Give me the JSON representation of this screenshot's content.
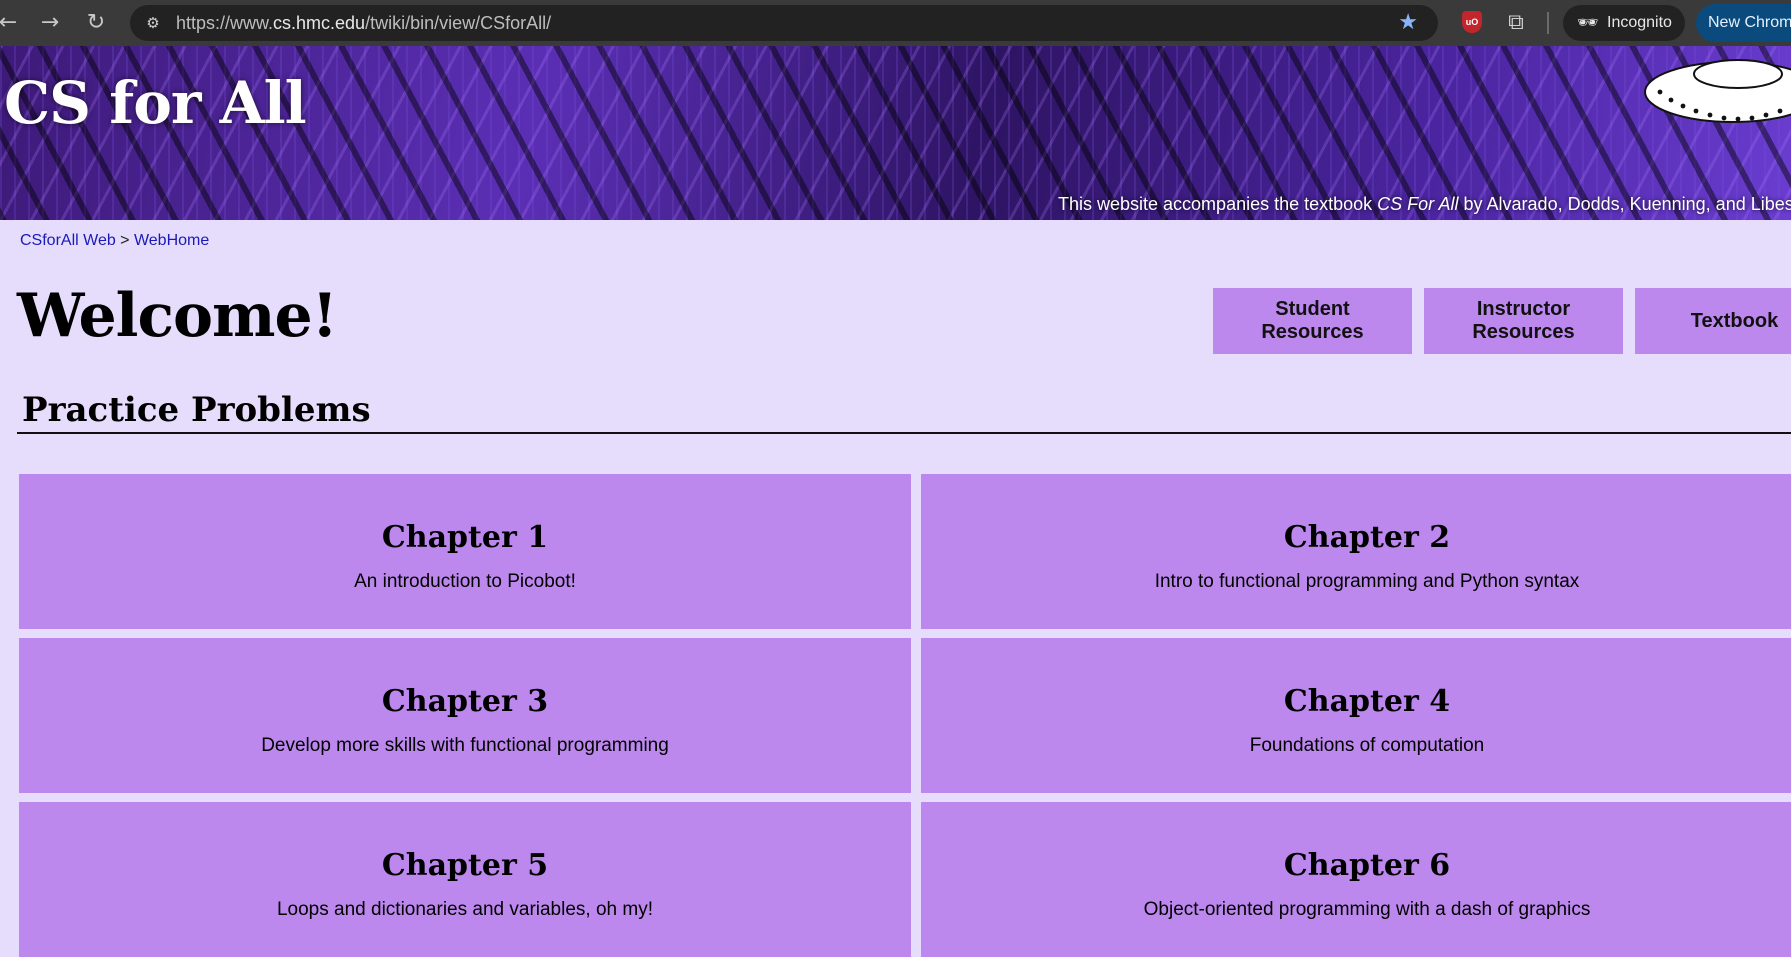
{
  "browser": {
    "back_icon": "arrow-left-icon",
    "forward_icon": "arrow-right-icon",
    "reload_icon": "reload-icon",
    "url_prefix": "https://www.",
    "url_host": "cs.hmc.edu",
    "url_path": "/twiki/bin/view/CSforAll/",
    "incognito_label": "Incognito",
    "new_chrome_label": "New Chrome",
    "ublock_label": "uO"
  },
  "banner": {
    "title": "CS for All",
    "tagline_pre": "This website accompanies the textbook ",
    "tagline_book": "CS For All",
    "tagline_post": " by Alvarado, Dodds, Kuenning, and Libeskind"
  },
  "breadcrumb": {
    "web": "CSforAll Web",
    "separator": " > ",
    "home": "WebHome"
  },
  "page": {
    "title": "Welcome!",
    "section_heading": "Practice Problems"
  },
  "resources": [
    {
      "label": "Student\nResources"
    },
    {
      "label": "Instructor\nResources"
    },
    {
      "label": "Textbook"
    }
  ],
  "chapters": [
    {
      "title": "Chapter 1",
      "desc": "An introduction to Picobot!"
    },
    {
      "title": "Chapter 2",
      "desc": "Intro to functional programming and Python syntax"
    },
    {
      "title": "Chapter 3",
      "desc": "Develop more skills with functional programming"
    },
    {
      "title": "Chapter 4",
      "desc": "Foundations of computation"
    },
    {
      "title": "Chapter 5",
      "desc": "Loops and dictionaries and variables, oh my!"
    },
    {
      "title": "Chapter 6",
      "desc": "Object-oriented programming with a dash of graphics"
    }
  ],
  "colors": {
    "page_bg": "#e6dcfb",
    "card_bg": "#bd88ee",
    "link": "#1a1ab8",
    "banner_purple": "#4b25a0"
  }
}
